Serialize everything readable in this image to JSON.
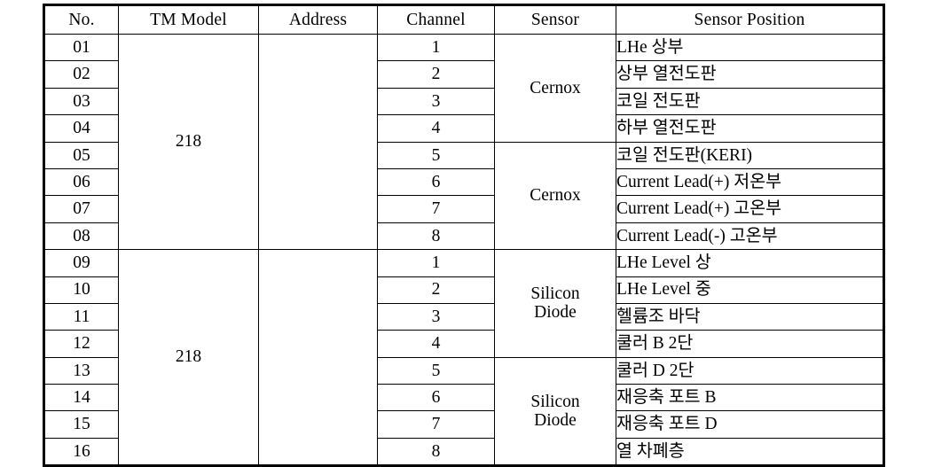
{
  "table": {
    "headers": [
      {
        "key": "no",
        "label": "No."
      },
      {
        "key": "tm",
        "label": "TM Model"
      },
      {
        "key": "address",
        "label": "Address"
      },
      {
        "key": "channel",
        "label": "Channel"
      },
      {
        "key": "sensor",
        "label": "Sensor"
      },
      {
        "key": "position",
        "label": "Sensor  Position"
      }
    ],
    "tm_groups": [
      {
        "label": "218",
        "rowspan": 8
      },
      {
        "label": "218",
        "rowspan": 8
      }
    ],
    "address_groups": [
      {
        "label": "",
        "rowspan": 8
      },
      {
        "label": "",
        "rowspan": 8
      }
    ],
    "sensor_groups": [
      {
        "label": "Cernox",
        "rowspan": 4
      },
      {
        "label": "Cernox",
        "rowspan": 4
      },
      {
        "label": "Silicon\nDiode",
        "rowspan": 4
      },
      {
        "label": "Silicon\nDiode",
        "rowspan": 4
      }
    ],
    "rows": [
      {
        "no": "01",
        "channel": "1",
        "position": "LHe 상부"
      },
      {
        "no": "02",
        "channel": "2",
        "position": "상부 열전도판"
      },
      {
        "no": "03",
        "channel": "3",
        "position": "코일 전도판"
      },
      {
        "no": "04",
        "channel": "4",
        "position": "하부 열전도판"
      },
      {
        "no": "05",
        "channel": "5",
        "position": "코일 전도판(KERI)"
      },
      {
        "no": "06",
        "channel": "6",
        "position": "Current Lead(+) 저온부"
      },
      {
        "no": "07",
        "channel": "7",
        "position": "Current Lead(+) 고온부"
      },
      {
        "no": "08",
        "channel": "8",
        "position": "Current Lead(-) 고온부"
      },
      {
        "no": "09",
        "channel": "1",
        "position": "LHe Level 상"
      },
      {
        "no": "10",
        "channel": "2",
        "position": "LHe Level 중"
      },
      {
        "no": "11",
        "channel": "3",
        "position": "헬륨조 바닥"
      },
      {
        "no": "12",
        "channel": "4",
        "position": "쿨러 B 2단"
      },
      {
        "no": "13",
        "channel": "5",
        "position": "쿨러 D 2단"
      },
      {
        "no": "14",
        "channel": "6",
        "position": "재응축 포트 B"
      },
      {
        "no": "15",
        "channel": "7",
        "position": "재응축 포트 D"
      },
      {
        "no": "16",
        "channel": "8",
        "position": "열 차폐층"
      }
    ]
  },
  "colors": {
    "text": "#000000",
    "border": "#000000",
    "background": "#ffffff"
  }
}
